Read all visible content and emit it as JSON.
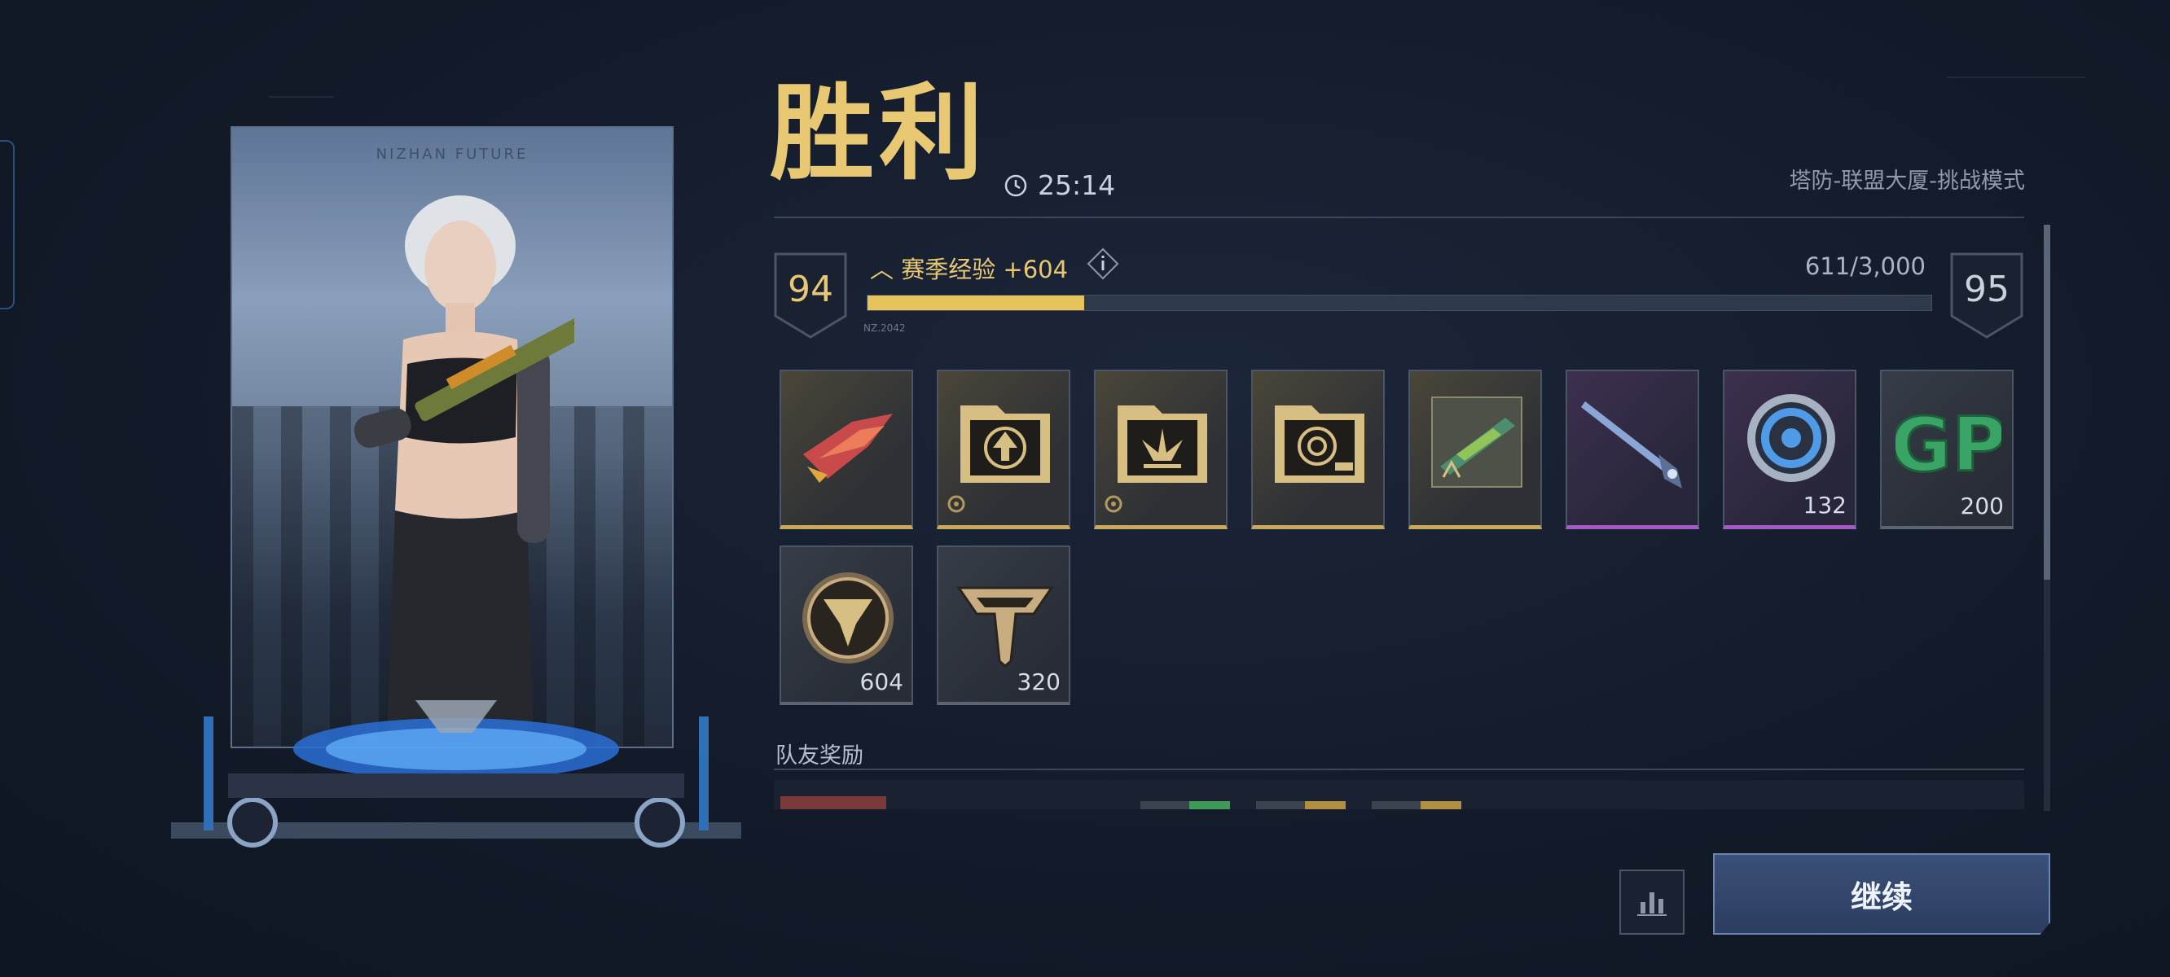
{
  "result": {
    "title": "胜利",
    "duration": "25:14",
    "mode": "塔防-联盟大厦-挑战模式"
  },
  "experience": {
    "current_level": "94",
    "next_level": "95",
    "label": "赛季经验 +604",
    "progress_text": "611/3,000",
    "progress_fraction": 0.2037,
    "tag": "NZ.2042"
  },
  "character": {
    "brand": "NIZHAN FUTURE"
  },
  "rewards": [
    {
      "icon": "red-fighter-weapon-icon",
      "rarity": "gold",
      "quantity": ""
    },
    {
      "icon": "gold-upgrade-folder-icon",
      "rarity": "gold",
      "quantity": ""
    },
    {
      "icon": "burst-skill-card-icon",
      "rarity": "gold",
      "quantity": ""
    },
    {
      "icon": "target-max-card-icon",
      "rarity": "gold",
      "quantity": ""
    },
    {
      "icon": "weapon-blueprint-icon",
      "rarity": "gold",
      "quantity": ""
    },
    {
      "icon": "blue-sword-icon",
      "rarity": "purple",
      "quantity": ""
    },
    {
      "icon": "blue-ring-token-icon",
      "rarity": "purple",
      "quantity": "132"
    },
    {
      "icon": "gp-currency-icon",
      "rarity": "gray",
      "quantity": "200"
    },
    {
      "icon": "gold-medal-token-icon",
      "rarity": "gray",
      "quantity": "604"
    },
    {
      "icon": "rank-emblem-icon",
      "rarity": "gray",
      "quantity": "320"
    }
  ],
  "teammates": {
    "label": "队友奖励"
  },
  "actions": {
    "continue_label": "继续",
    "stats_icon": "bar-chart-icon"
  },
  "colors": {
    "gold": "#e8c873",
    "exp_fill": "#e8c25a",
    "purple_rarity": "#a35ac5",
    "button_blue": "#2b3d60"
  }
}
